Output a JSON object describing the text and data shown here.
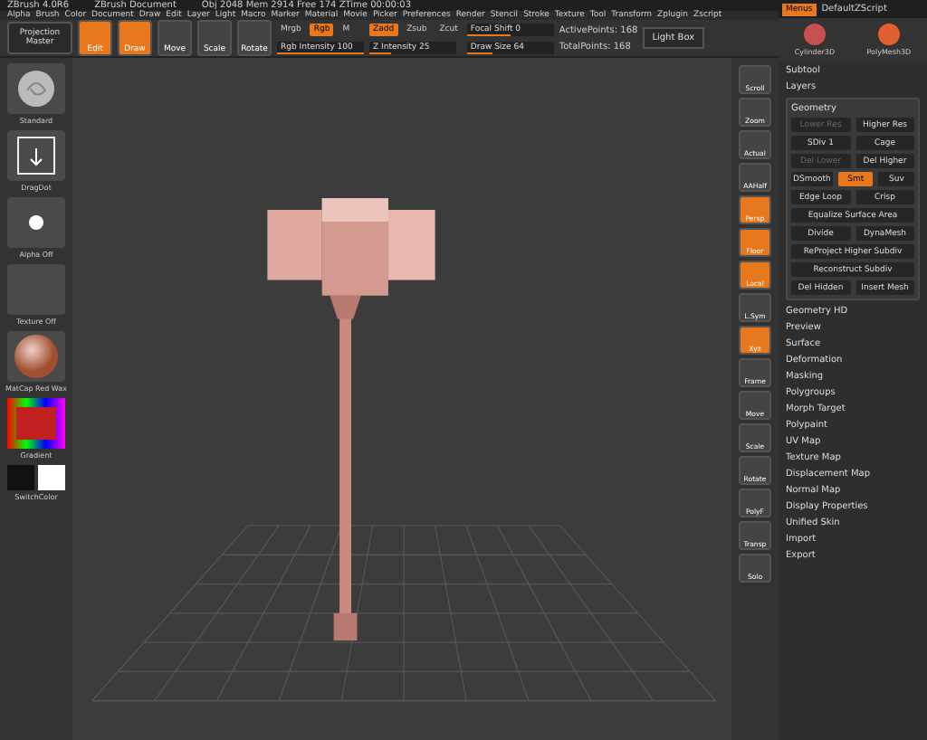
{
  "title_bar": {
    "texts": [
      "ZBrush 4.0R6",
      "ZBrush Document",
      "Obj 2048 Mem 2914 Free 174 ZTime 00:00:03"
    ]
  },
  "menu": [
    "Alpha",
    "Brush",
    "Color",
    "Document",
    "Draw",
    "Edit",
    "Layer",
    "Light",
    "Macro",
    "Marker",
    "Material",
    "Movie",
    "Picker",
    "Preferences",
    "Render",
    "Stencil",
    "Stroke",
    "Texture",
    "Tool",
    "Transform",
    "Zplugin",
    "Zscript"
  ],
  "top_right": {
    "menus_button": {
      "label": "Menus",
      "selected": true
    },
    "script_label": "DefaultZScript",
    "tools": [
      {
        "label": "Cylinder3D"
      },
      {
        "label": "PolyMesh3D"
      }
    ]
  },
  "shelf": {
    "projection": "Projection Master",
    "modes": [
      {
        "label": "Edit",
        "selected": true
      },
      {
        "label": "Draw",
        "selected": true
      },
      {
        "label": "Move",
        "selected": false
      },
      {
        "label": "Scale",
        "selected": false
      },
      {
        "label": "Rotate",
        "selected": false
      }
    ],
    "color_toggles": [
      {
        "label": "Mrgb",
        "selected": false
      },
      {
        "label": "Rgb",
        "selected": true
      },
      {
        "label": "M",
        "selected": false
      }
    ],
    "rgb_slider": {
      "label": "Rgb Intensity 100",
      "level": 1
    },
    "z_toggles": [
      {
        "label": "Zadd",
        "selected": true
      },
      {
        "label": "Zsub",
        "selected": false
      },
      {
        "label": "Zcut",
        "selected": false
      }
    ],
    "z_slider": {
      "label": "Z Intensity 25",
      "level": 0.25
    },
    "focal": {
      "label": "Focal Shift 0",
      "level": 0.5
    },
    "size": {
      "label": "Draw Size 64",
      "level": 0.3
    },
    "stats": [
      "ActivePoints: 168",
      "TotalPoints: 168"
    ],
    "lightbox": "Light Box"
  },
  "left_shelf": [
    {
      "kind": "brush",
      "label": "Standard"
    },
    {
      "kind": "stroke",
      "label": "DragDot"
    },
    {
      "kind": "alpha",
      "label": "Alpha Off"
    },
    {
      "kind": "texture",
      "label": "Texture Off"
    },
    {
      "kind": "material",
      "label": "MatCap Red Wax"
    },
    {
      "kind": "gradient",
      "label": "Gradient"
    },
    {
      "kind": "swatches",
      "label": "SwitchColor"
    }
  ],
  "right_icons": [
    {
      "label": "Scroll",
      "selected": false
    },
    {
      "label": "Zoom",
      "selected": false
    },
    {
      "label": "Actual",
      "selected": false
    },
    {
      "label": "AAHalf",
      "selected": false
    },
    {
      "label": "Persp",
      "selected": true
    },
    {
      "label": "Floor",
      "selected": true
    },
    {
      "label": "Local",
      "selected": true
    },
    {
      "label": "L.Sym",
      "selected": false
    },
    {
      "label": "Xyz",
      "selected": true
    },
    {
      "label": "Frame",
      "selected": false
    },
    {
      "label": "Move",
      "selected": false
    },
    {
      "label": "Scale",
      "selected": false
    },
    {
      "label": "Rotate",
      "selected": false
    },
    {
      "label": "PolyF",
      "selected": false
    },
    {
      "label": "Transp",
      "selected": false
    },
    {
      "label": "Solo",
      "selected": false
    }
  ],
  "tool_panel": {
    "top_items": [
      "Subtool",
      "Layers"
    ],
    "geometry": {
      "title": "Geometry",
      "rows": [
        [
          {
            "label": "Lower Res",
            "selected": false,
            "disabled": true
          },
          {
            "label": "Higher Res",
            "selected": false,
            "disabled": false
          }
        ],
        [
          {
            "label": "SDiv 1",
            "selected": false,
            "disabled": false
          },
          {
            "label": "Cage",
            "selected": false,
            "disabled": false
          }
        ],
        [
          {
            "label": "Del Lower",
            "selected": false,
            "disabled": true
          },
          {
            "label": "Del Higher",
            "selected": false,
            "disabled": false
          }
        ],
        [
          {
            "label": "DSmooth",
            "selected": false,
            "disabled": false
          },
          {
            "label": "Smt",
            "selected": true,
            "disabled": false
          },
          {
            "label": "Suv",
            "selected": false,
            "disabled": false
          }
        ],
        [
          {
            "label": "Edge Loop",
            "selected": false,
            "disabled": false
          },
          {
            "label": "Crisp",
            "selected": false,
            "disabled": false
          }
        ],
        [
          {
            "label": "Equalize Surface Area",
            "selected": false,
            "disabled": false
          }
        ],
        [
          {
            "label": "Divide",
            "selected": false,
            "disabled": false
          },
          {
            "label": "DynaMesh",
            "selected": false,
            "disabled": false
          }
        ],
        [
          {
            "label": "ReProject Higher Subdiv",
            "selected": false,
            "disabled": false
          }
        ],
        [
          {
            "label": "Reconstruct Subdiv",
            "selected": false,
            "disabled": false
          }
        ],
        [
          {
            "label": "Del Hidden",
            "selected": false,
            "disabled": false
          },
          {
            "label": "Insert Mesh",
            "selected": false,
            "disabled": false
          }
        ]
      ]
    },
    "sections": [
      "Geometry HD",
      "Preview",
      "Surface",
      "Deformation",
      "Masking",
      "Polygroups",
      "Morph Target",
      "Polypaint",
      "UV Map",
      "Texture Map",
      "Displacement Map",
      "Normal Map",
      "Display Properties",
      "Unified Skin",
      "Import",
      "Export"
    ]
  }
}
